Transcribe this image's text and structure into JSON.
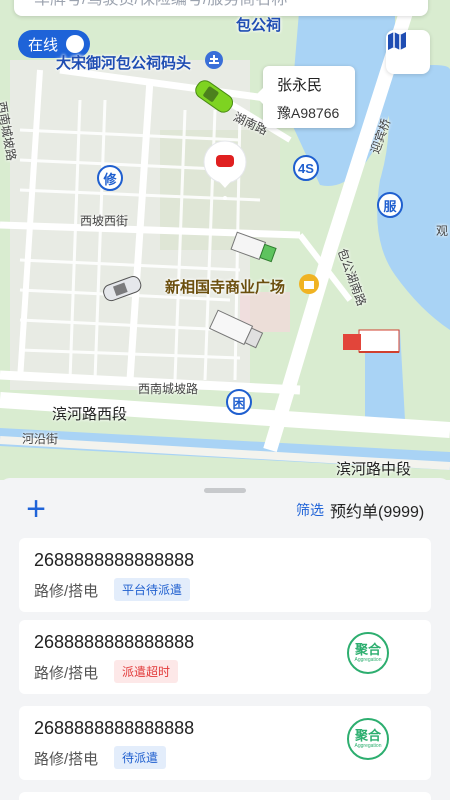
{
  "search": {
    "placeholder": "车牌号/驾驶员/保险编号/服务商名称"
  },
  "status_toggle": {
    "label": "在线"
  },
  "map": {
    "poi_top": "包公祠",
    "poi_dock": "大宋御河包公祠码头",
    "poi_plaza": "新相国寺商业广场",
    "roads": {
      "xinan_chengpo": "西南城坡路",
      "xipo_xijie": "西坡西街",
      "xinan_chengpo2": "西南城坡路",
      "binhe_xiduan": "滨河路西段",
      "heyan_jie": "河沿街",
      "binhe_zhongduan": "滨河路中段",
      "yingbin_qiao": "迎宾桥",
      "baogong_hunan": "包公湖南路",
      "bao_nan_lu": "湖南路"
    },
    "badges": {
      "repair": "修",
      "fours": "4S",
      "service": "服",
      "sleepy": "困"
    },
    "edge_text": "观",
    "driver_bubble": {
      "name": "张永民",
      "plate": "豫A98766"
    }
  },
  "sheet": {
    "add_label": "+",
    "filter_label": "筛选",
    "title": "预约单(9999)",
    "orders": [
      {
        "order_no": "2688888888888888",
        "service": "路修/搭电",
        "status": "平台待派遣",
        "status_color": "blue",
        "stamp": false
      },
      {
        "order_no": "2688888888888888",
        "service": "路修/搭电",
        "status": "派遣超时",
        "status_color": "red",
        "stamp": true,
        "stamp_text": "聚合",
        "stamp_sub": "Aggregation"
      },
      {
        "order_no": "2688888888888888",
        "service": "路修/搭电",
        "status": "待派遣",
        "status_color": "blue",
        "stamp": true,
        "stamp_text": "聚合",
        "stamp_sub": "Aggregation"
      }
    ]
  },
  "colors": {
    "accent": "#1f63d8",
    "water": "#a9d3f5",
    "park": "#cfe6c3",
    "timeout": "#e23a3a",
    "aggregate": "#2dae6f"
  }
}
